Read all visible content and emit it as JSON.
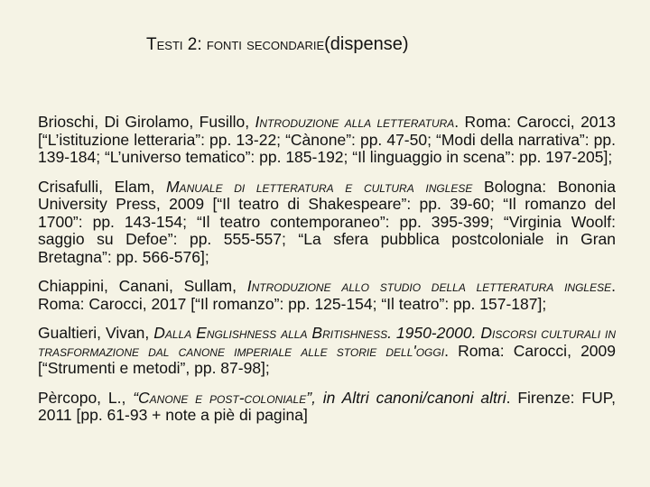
{
  "header": {
    "title_main": "Testi 2: fonti secondarie",
    "title_note": "(dispense)"
  },
  "entries": [
    {
      "authors": "Brioschi, Di Girolamo, Fusillo, ",
      "book": "Introduzione alla letteratura",
      "details": ". Roma: Carocci, 2013 [“L’istituzione letteraria”: pp. 13-22; “Cànone”: pp. 47-50; “Modi della narrativa”: pp. 139-184; “L’universo tematico”: pp. 185-192; “Il linguaggio in scena”: pp. 197-205];"
    },
    {
      "authors": "Crisafulli, Elam, ",
      "book": "Manuale di letteratura e cultura inglese",
      "details": " Bologna: Bononia University Press, 2009 [“Il teatro di Shakespeare”: pp. 39-60; “Il romanzo del 1700”: pp. 143-154; “Il teatro contemporaneo”: pp. 395-399; “Virginia Woolf: saggio su Defoe”: pp. 555-557; “La sfera pubblica postcoloniale in Gran Bretagna”: pp. 566-576];"
    },
    {
      "authors": "Chiappini, Canani, Sullam, ",
      "book": "Introduzione allo studio della letteratura inglese",
      "details": ". Roma: Carocci, 2017 [“Il romanzo”: pp. 125-154; “Il teatro”: pp. 157-187];"
    },
    {
      "authors": "Gualtieri, Vivan, ",
      "book": "Dalla Englishness alla Britishness. 1950-2000. Discorsi culturali in trasformazione dal canone imperiale alle storie dell'oggi",
      "details": ". Roma: Carocci, 2009 [“Strumenti e metodi”, pp. 87-98];"
    },
    {
      "authors": "Pèrcopo, L., ",
      "book": "“Canone e post-coloniale”",
      "details_italic": ", in Altri canoni/canoni altri",
      "details": ". Firenze: FUP, 2011 [pp. 61-93 + note a piè di pagina]"
    }
  ]
}
